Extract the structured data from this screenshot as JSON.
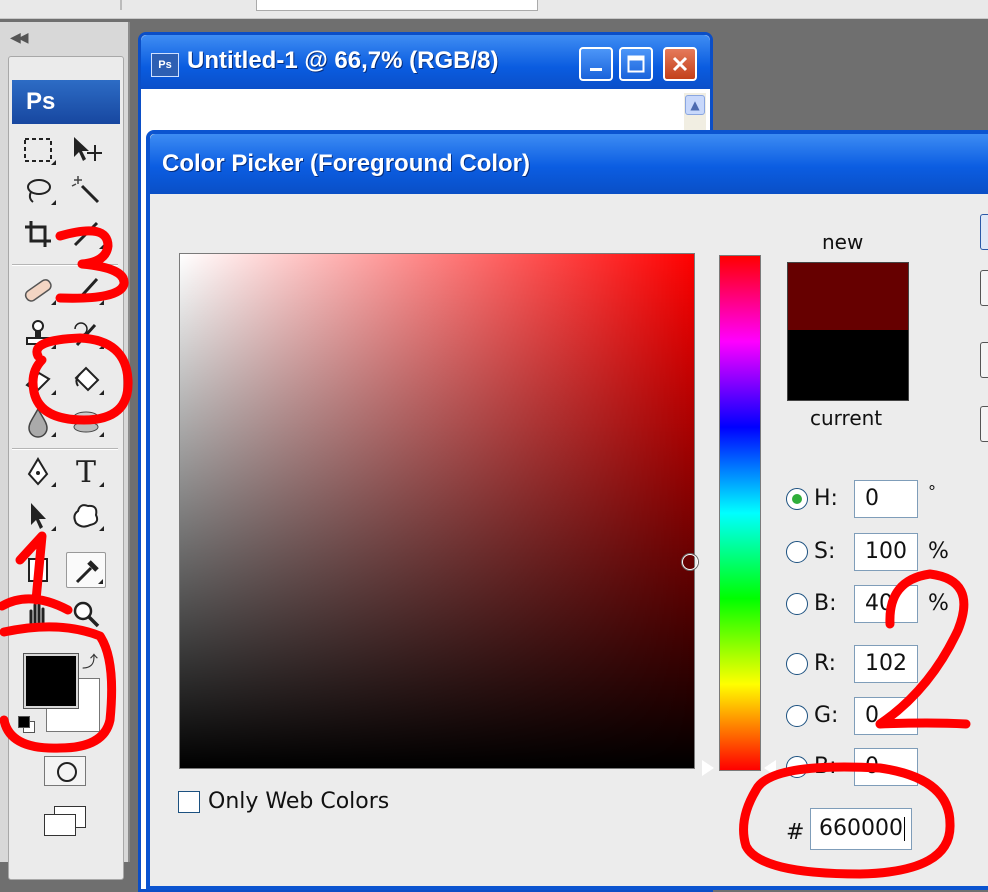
{
  "document": {
    "icon_text": "Ps",
    "title": "Untitled-1 @ 66,7% (RGB/8)"
  },
  "toolbox": {
    "logo": "Ps",
    "type_tool_glyph": "T",
    "tools": [
      "marquee-icon",
      "move-icon",
      "lasso-icon",
      "magic-wand-icon",
      "crop-icon",
      "slice-icon",
      "healing-brush-icon",
      "brush-icon",
      "clone-stamp-icon",
      "history-brush-icon",
      "eraser-icon",
      "paint-bucket-icon",
      "blur-icon",
      "dodge-icon",
      "pen-icon",
      "type-icon",
      "path-selection-icon",
      "custom-shape-icon",
      "notes-icon",
      "eyedropper-icon",
      "hand-icon",
      "zoom-icon"
    ],
    "foreground_color": "#000000",
    "background_color": "#ffffff"
  },
  "picker": {
    "title": "Color Picker (Foreground Color)",
    "new_label": "new",
    "current_label": "current",
    "new_color": "#660000",
    "current_color": "#000000",
    "fields": {
      "h": {
        "label": "H:",
        "value": "0",
        "unit": "°",
        "selected": true
      },
      "s": {
        "label": "S:",
        "value": "100",
        "unit": "%"
      },
      "b": {
        "label": "B:",
        "value": "40",
        "unit": "%"
      },
      "r": {
        "label": "R:",
        "value": "102"
      },
      "g": {
        "label": "G:",
        "value": "0"
      },
      "b2": {
        "label": "B:",
        "value": "0"
      }
    },
    "only_web_colors_label": "Only Web Colors",
    "hex_prefix": "#",
    "hex_value": "660000"
  },
  "annotations": {
    "color": "#ff0000",
    "marks": [
      "1",
      "2",
      "3"
    ]
  }
}
